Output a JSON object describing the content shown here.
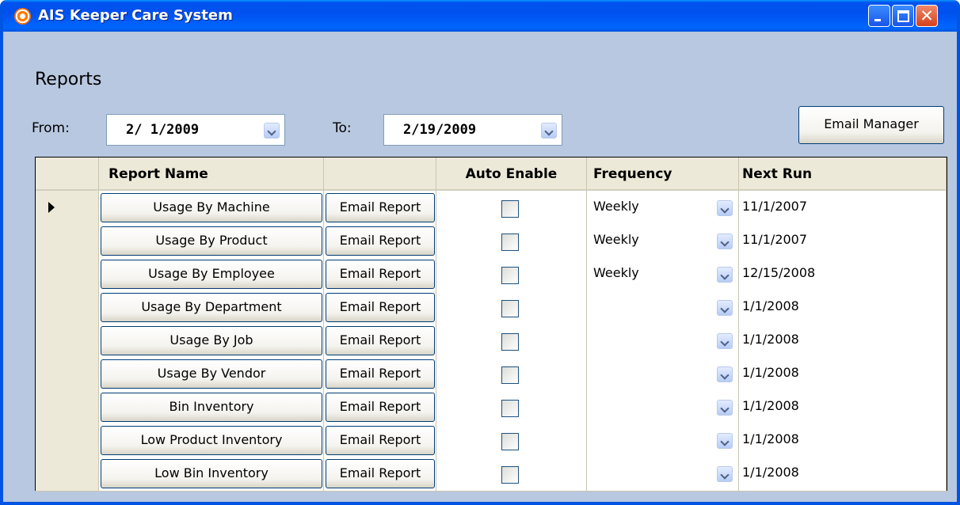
{
  "window": {
    "title": "AIS Keeper Care System"
  },
  "page": {
    "heading": "Reports"
  },
  "filters": {
    "from_label": "From:",
    "from_value": "2/ 1/2009",
    "to_label": "To:",
    "to_value": "2/19/2009"
  },
  "actions": {
    "email_manager_label": "Email Manager"
  },
  "grid": {
    "columns": [
      "Report Name",
      "",
      "Auto Enable",
      "Frequency",
      "Next Run"
    ],
    "rows": [
      {
        "report": "Usage By Machine",
        "email": "Email Report",
        "auto_enable": false,
        "frequency": "Weekly",
        "next_run": "11/1/2007",
        "current": true
      },
      {
        "report": "Usage By Product",
        "email": "Email Report",
        "auto_enable": false,
        "frequency": "Weekly",
        "next_run": "11/1/2007",
        "current": false
      },
      {
        "report": "Usage By Employee",
        "email": "Email Report",
        "auto_enable": false,
        "frequency": "Weekly",
        "next_run": "12/15/2008",
        "current": false
      },
      {
        "report": "Usage By Department",
        "email": "Email Report",
        "auto_enable": false,
        "frequency": "",
        "next_run": "1/1/2008",
        "current": false
      },
      {
        "report": "Usage By Job",
        "email": "Email Report",
        "auto_enable": false,
        "frequency": "",
        "next_run": "1/1/2008",
        "current": false
      },
      {
        "report": "Usage By Vendor",
        "email": "Email Report",
        "auto_enable": false,
        "frequency": "",
        "next_run": "1/1/2008",
        "current": false
      },
      {
        "report": "Bin Inventory",
        "email": "Email Report",
        "auto_enable": false,
        "frequency": "",
        "next_run": "1/1/2008",
        "current": false
      },
      {
        "report": "Low Product Inventory",
        "email": "Email Report",
        "auto_enable": false,
        "frequency": "",
        "next_run": "1/1/2008",
        "current": false
      },
      {
        "report": "Low Bin Inventory",
        "email": "Email Report",
        "auto_enable": false,
        "frequency": "",
        "next_run": "1/1/2008",
        "current": false
      }
    ]
  }
}
